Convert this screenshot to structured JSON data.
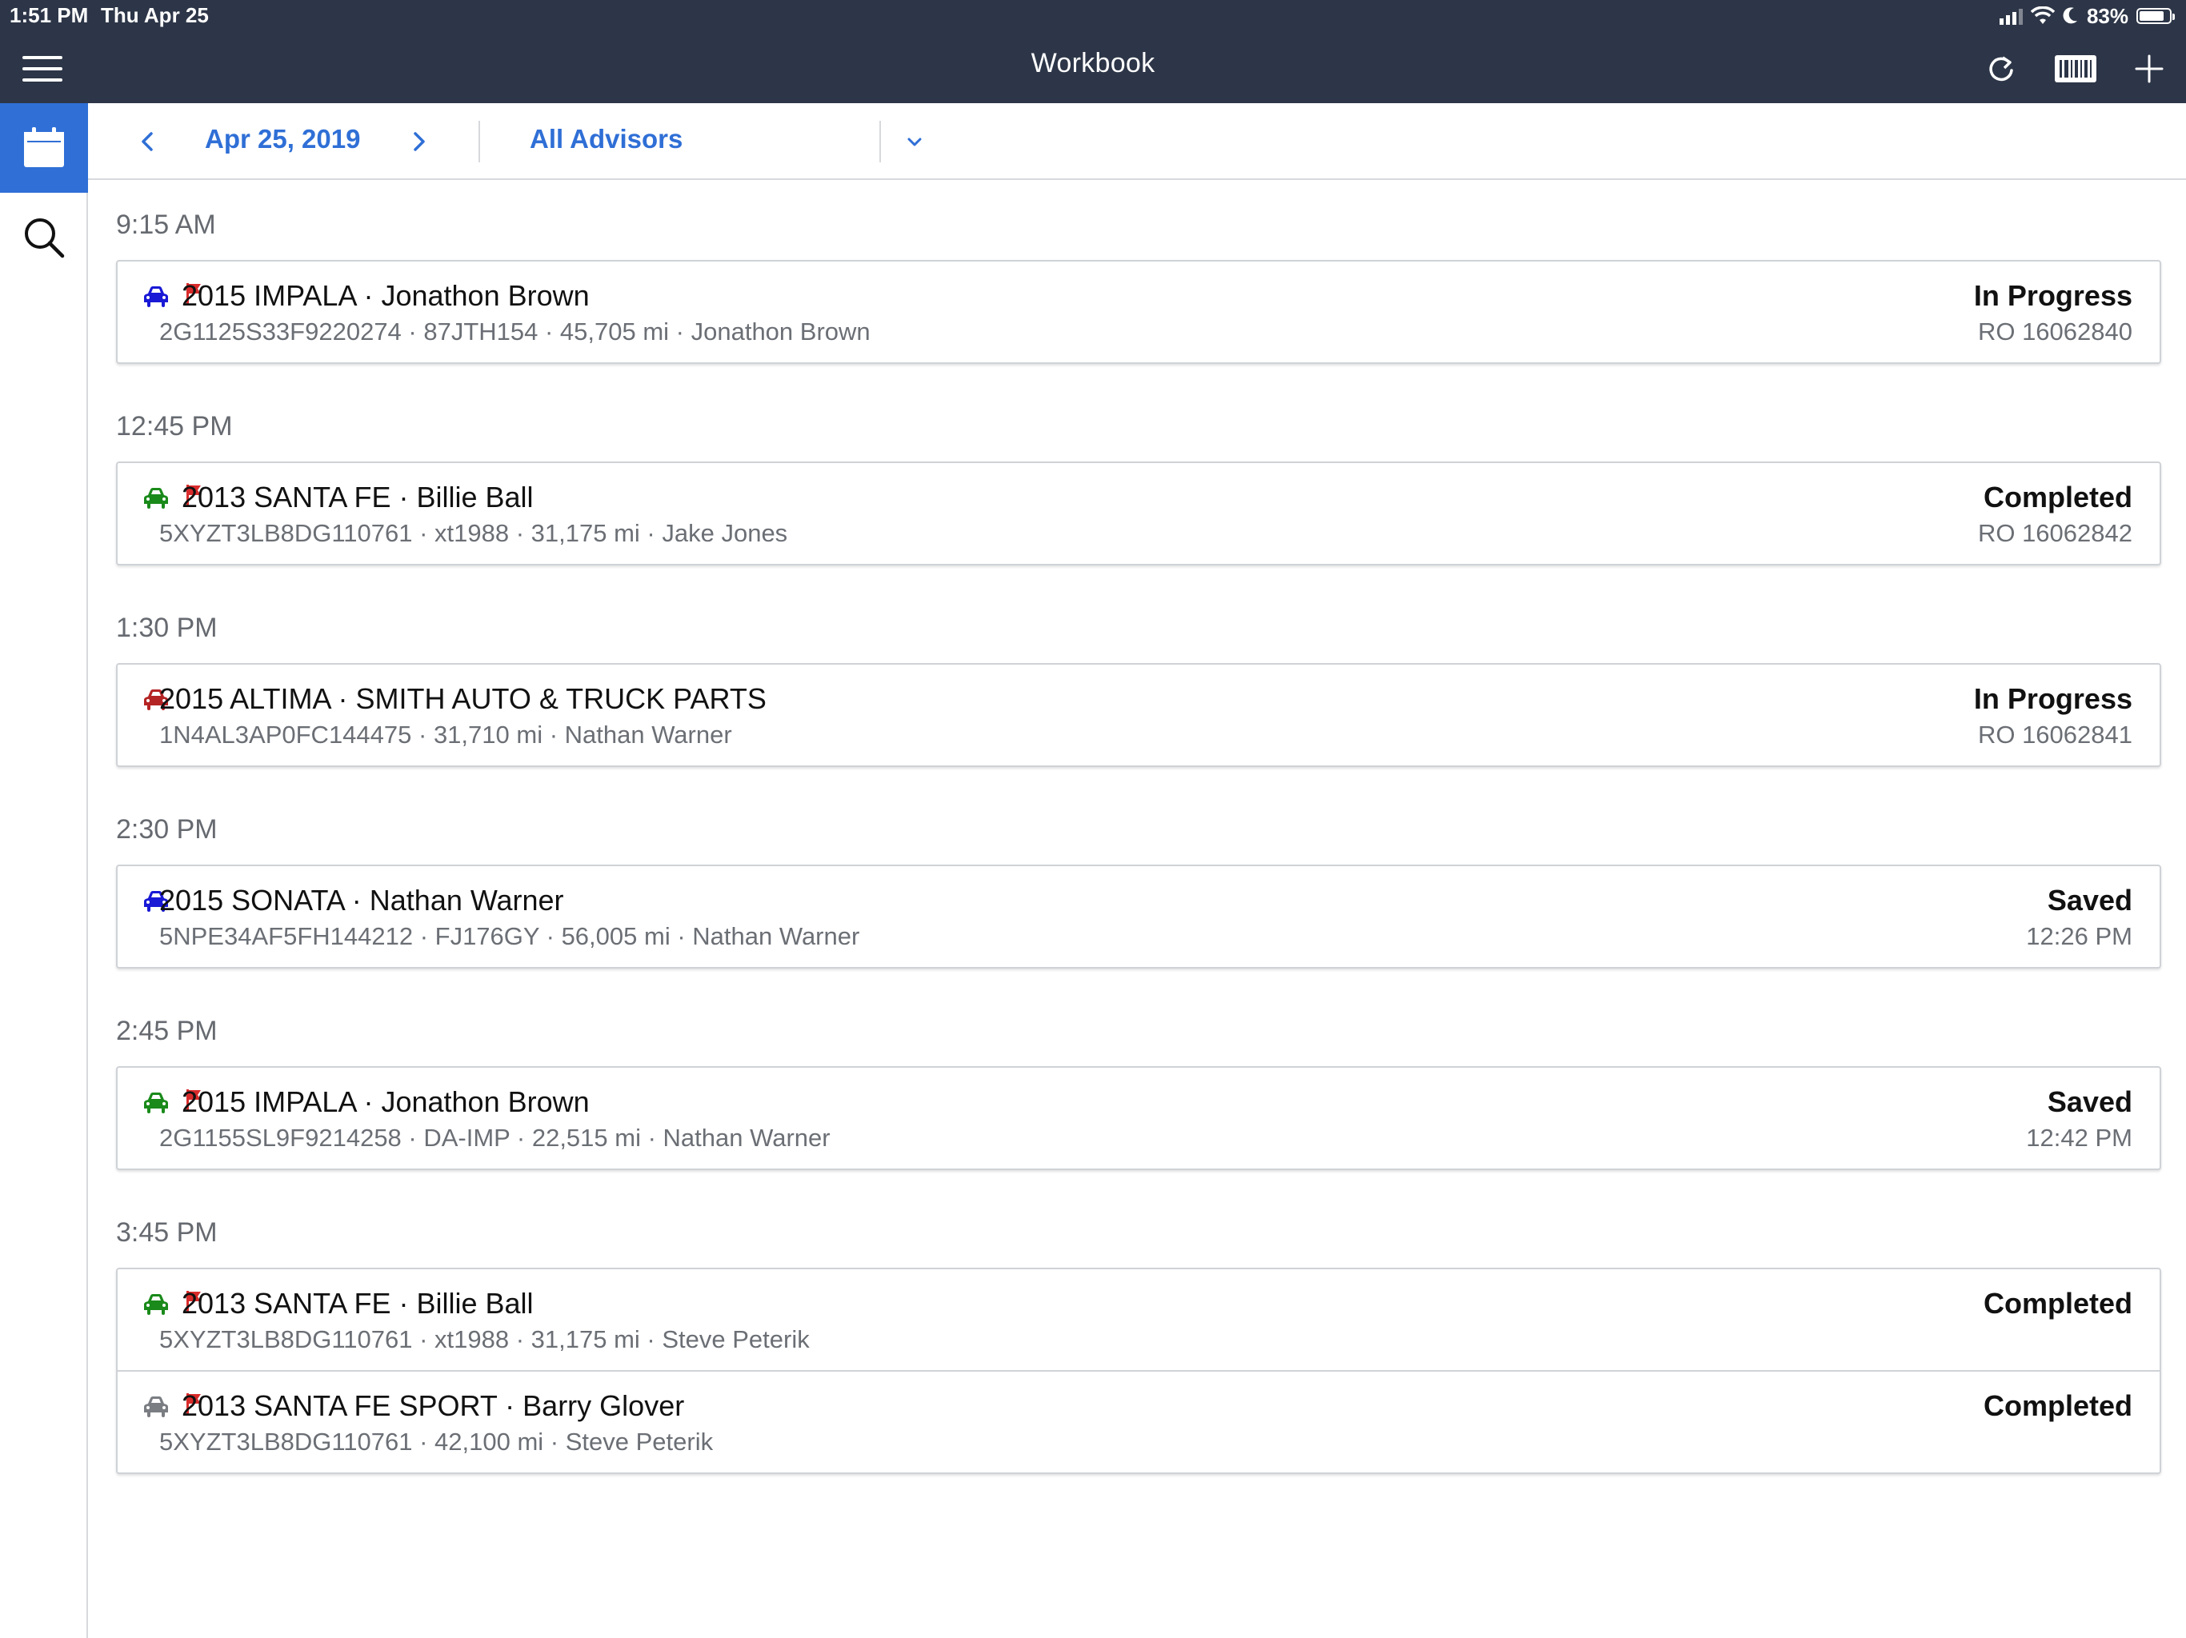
{
  "status_bar": {
    "time": "1:51 PM",
    "date": "Thu Apr 25",
    "battery": "83%",
    "battery_level": 0.83
  },
  "nav": {
    "title": "Workbook"
  },
  "filters": {
    "date": "Apr 25, 2019",
    "advisor": "All Advisors"
  },
  "colors": {
    "accent": "#2f6fd6",
    "header_bg": "#2d3648",
    "flag": "#d92b2b",
    "car_blue": "#1919d6",
    "car_green": "#1a8a1a",
    "car_red": "#b52424",
    "car_gray": "#7a7d82"
  },
  "groups": [
    {
      "time": "9:15 AM",
      "rows": [
        {
          "car_color": "blue",
          "flag": true,
          "title": "2015 IMPALA · Jonathon Brown",
          "subtitle": "2G1125S33F9220274 · 87JTH154 · 45,705 mi · Jonathon Brown",
          "status": "In Progress",
          "detail": "RO 16062840"
        }
      ]
    },
    {
      "time": "12:45 PM",
      "rows": [
        {
          "car_color": "green",
          "flag": true,
          "title": "2013 SANTA FE · Billie Ball",
          "subtitle": "5XYZT3LB8DG110761 · xt1988 · 31,175 mi · Jake Jones",
          "status": "Completed",
          "detail": "RO 16062842"
        }
      ]
    },
    {
      "time": "1:30 PM",
      "rows": [
        {
          "car_color": "red",
          "flag": false,
          "title": "2015 ALTIMA ·  SMITH AUTO & TRUCK PARTS",
          "subtitle": "1N4AL3AP0FC144475 · 31,710 mi · Nathan Warner",
          "status": "In Progress",
          "detail": "RO 16062841"
        }
      ]
    },
    {
      "time": "2:30 PM",
      "rows": [
        {
          "car_color": "blue",
          "flag": false,
          "title": "2015 SONATA · Nathan Warner",
          "subtitle": "5NPE34AF5FH144212 · FJ176GY · 56,005 mi · Nathan Warner",
          "status": "Saved",
          "detail": "12:26 PM"
        }
      ]
    },
    {
      "time": "2:45 PM",
      "rows": [
        {
          "car_color": "green",
          "flag": true,
          "title": "2015 IMPALA · Jonathon Brown",
          "subtitle": "2G1155SL9F9214258 · DA-IMP · 22,515 mi · Nathan Warner",
          "status": "Saved",
          "detail": "12:42 PM"
        }
      ]
    },
    {
      "time": "3:45 PM",
      "rows": [
        {
          "car_color": "green",
          "flag": true,
          "title": "2013 SANTA FE · Billie Ball",
          "subtitle": "5XYZT3LB8DG110761 · xt1988 · 31,175 mi · Steve Peterik",
          "status": "Completed",
          "detail": ""
        },
        {
          "car_color": "gray",
          "flag": true,
          "title": "2013 SANTA FE SPORT · Barry Glover",
          "subtitle": "5XYZT3LB8DG110761 · 42,100 mi · Steve Peterik",
          "status": "Completed",
          "detail": ""
        }
      ]
    }
  ]
}
